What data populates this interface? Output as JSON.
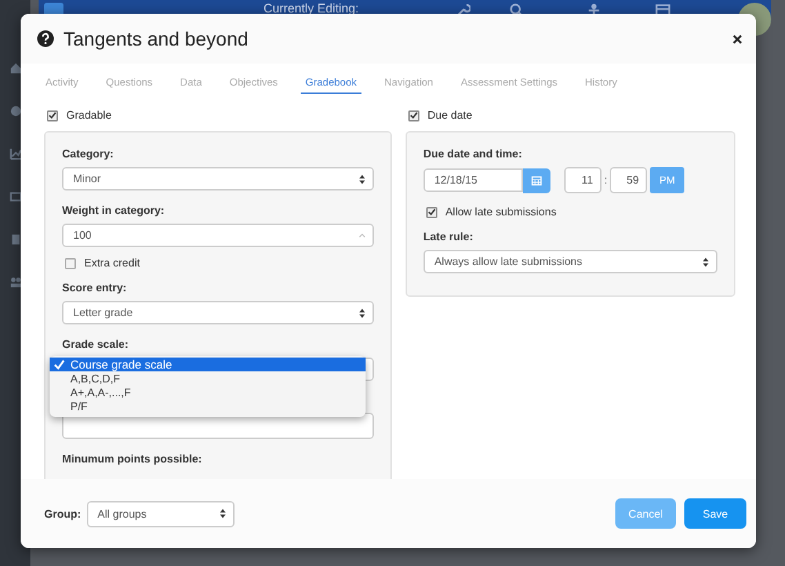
{
  "app_header": {
    "editing_label": "Currently Editing:"
  },
  "dialog": {
    "title": "Tangents and beyond"
  },
  "tabs": [
    {
      "label": "Activity",
      "selected": false
    },
    {
      "label": "Questions",
      "selected": false
    },
    {
      "label": "Data",
      "selected": false
    },
    {
      "label": "Objectives",
      "selected": false
    },
    {
      "label": "Gradebook",
      "selected": true
    },
    {
      "label": "Navigation",
      "selected": false
    },
    {
      "label": "Assessment Settings",
      "selected": false
    },
    {
      "label": "History",
      "selected": false
    }
  ],
  "gradable": {
    "label": "Gradable",
    "checked": true
  },
  "category": {
    "label": "Category:",
    "value": "Minor"
  },
  "weight": {
    "label": "Weight in category:",
    "value": "100"
  },
  "extra_credit": {
    "label": "Extra credit",
    "checked": false
  },
  "score_entry": {
    "label": "Score entry:",
    "value": "Letter grade"
  },
  "grade_scale": {
    "label": "Grade scale:",
    "options": [
      {
        "label": "Course grade scale",
        "selected": true
      },
      {
        "label": "A,B,C,D,F",
        "selected": false
      },
      {
        "label": "A+,A,A-,...,F",
        "selected": false
      },
      {
        "label": "P/F",
        "selected": false
      }
    ]
  },
  "minimum_points": {
    "label": "Minumum points possible:"
  },
  "due_date": {
    "label": "Due date",
    "checked": true
  },
  "due_date_time": {
    "label": "Due date and time:",
    "date": "12/18/15",
    "hour": "11",
    "separator": ":",
    "minute": "59",
    "ampm": "PM"
  },
  "allow_late": {
    "label": "Allow late submissions",
    "checked": true
  },
  "late_rule": {
    "label": "Late rule:",
    "value": "Always allow late submissions"
  },
  "group": {
    "label": "Group:",
    "value": "All groups"
  },
  "buttons": [
    {
      "label": "Cancel",
      "kind": "secondary"
    },
    {
      "label": "Save",
      "kind": "primary"
    }
  ]
}
